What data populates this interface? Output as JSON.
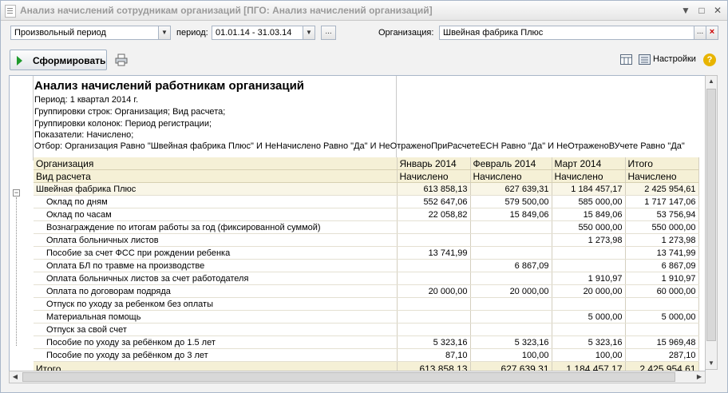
{
  "window": {
    "title": "Анализ начислений сотрудникам организаций [ПГО: Анализ начислений организаций]"
  },
  "filters": {
    "period_type": "Произвольный период",
    "period_label": "период:",
    "period_value": "01.01.14 - 31.03.14",
    "period_picker": "...",
    "org_label": "Организация:",
    "org_value": "Швейная фабрика Плюс",
    "org_picker": "...",
    "org_clear": "×"
  },
  "toolbar": {
    "generate_label": "Сформировать",
    "settings_label": "Настройки",
    "help_label": "?"
  },
  "report": {
    "title": "Анализ начислений работникам организаций",
    "header_lines": [
      "Период: 1 квартал 2014 г.",
      "Группировки строк: Организация; Вид расчета;",
      "Группировки колонок: Период регистрации;",
      "Показатели: Начислено;",
      "Отбор: Организация Равно \"Швейная фабрика Плюс\" И НеНачислено Равно \"Да\" И НеОтраженоПриРасчетеЕСН Равно \"Да\" И НеОтраженоВУчете Равно \"Да\""
    ],
    "columns": {
      "org": "Организация",
      "kind": "Вид расчета",
      "periods": [
        "Январь 2014",
        "Февраль 2014",
        "Март 2014",
        "Итого"
      ],
      "measure": "Начислено"
    },
    "group": {
      "name": "Швейная фабрика Плюс",
      "values": [
        "613 858,13",
        "627 639,31",
        "1 184 457,17",
        "2 425 954,61"
      ]
    },
    "rows": [
      {
        "name": "Оклад по дням",
        "values": [
          "552 647,06",
          "579 500,00",
          "585 000,00",
          "1 717 147,06"
        ]
      },
      {
        "name": "Оклад по часам",
        "values": [
          "22 058,82",
          "15 849,06",
          "15 849,06",
          "53 756,94"
        ]
      },
      {
        "name": "Вознаграждение по итогам работы за год (фиксированной суммой)",
        "values": [
          "",
          "",
          "550 000,00",
          "550 000,00"
        ]
      },
      {
        "name": "Оплата больничных листов",
        "values": [
          "",
          "",
          "1 273,98",
          "1 273,98"
        ]
      },
      {
        "name": "Пособие за счет ФСС при рождении ребенка",
        "values": [
          "13 741,99",
          "",
          "",
          "13 741,99"
        ]
      },
      {
        "name": "Оплата БЛ по травме на производстве",
        "values": [
          "",
          "6 867,09",
          "",
          "6 867,09"
        ]
      },
      {
        "name": "Оплата больничных листов за счет работодателя",
        "values": [
          "",
          "",
          "1 910,97",
          "1 910,97"
        ]
      },
      {
        "name": "Оплата по договорам подряда",
        "values": [
          "20 000,00",
          "20 000,00",
          "20 000,00",
          "60 000,00"
        ]
      },
      {
        "name": "Отпуск по уходу за ребенком без оплаты",
        "values": [
          "",
          "",
          "",
          ""
        ]
      },
      {
        "name": "Материальная помощь",
        "values": [
          "",
          "",
          "5 000,00",
          "5 000,00"
        ]
      },
      {
        "name": "Отпуск за свой счет",
        "values": [
          "",
          "",
          "",
          ""
        ]
      },
      {
        "name": "Пособие по уходу за ребёнком до 1.5 лет",
        "values": [
          "5 323,16",
          "5 323,16",
          "5 323,16",
          "15 969,48"
        ]
      },
      {
        "name": "Пособие по уходу за ребёнком до 3 лет",
        "values": [
          "87,10",
          "100,00",
          "100,00",
          "287,10"
        ]
      }
    ],
    "total": {
      "label": "Итого",
      "values": [
        "613 858,13",
        "627 639,31",
        "1 184 457,17",
        "2 425 954,61"
      ]
    }
  },
  "colors": {
    "header_bg": "#f5f0d6",
    "run_arrow": "#1e9a2b",
    "help": "#e8b400"
  }
}
